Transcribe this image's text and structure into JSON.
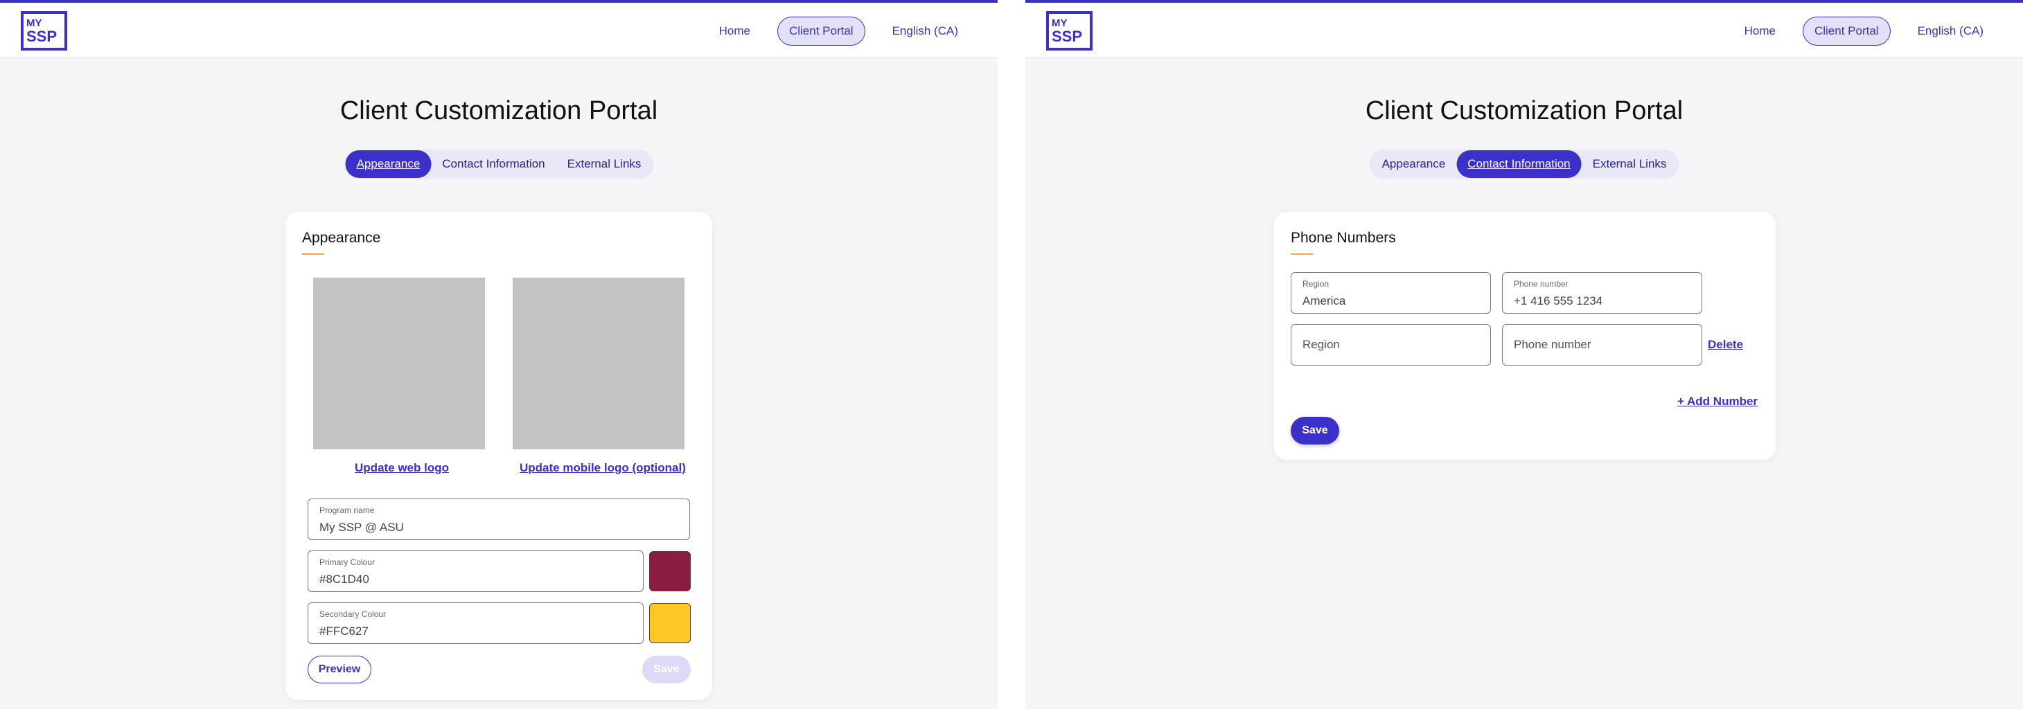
{
  "colors": {
    "accent": "#3b30c9",
    "primary_swatch": "#8C1D40",
    "secondary_swatch": "#FFC627"
  },
  "nav": {
    "logo_line1": "MY",
    "logo_line2": "SSP",
    "links": [
      "Home",
      "Client Portal",
      "English (CA)"
    ],
    "active_link": "Client Portal"
  },
  "page": {
    "title": "Client Customization Portal",
    "tabs": [
      "Appearance",
      "Contact Information",
      "External Links"
    ]
  },
  "appearance": {
    "card_title": "Appearance",
    "update_web_logo": "Update web logo",
    "update_mobile_logo": "Update mobile logo (optional)",
    "program_name": {
      "label": "Program name",
      "value": "My SSP @ ASU"
    },
    "primary_colour": {
      "label": "Primary Colour",
      "value": "#8C1D40"
    },
    "secondary_colour": {
      "label": "Secondary Colour",
      "value": "#FFC627"
    },
    "preview_label": "Preview",
    "save_label": "Save"
  },
  "contact": {
    "card_title": "Phone Numbers",
    "rows": [
      {
        "region_label": "Region",
        "region_value": "America",
        "phone_label": "Phone number",
        "phone_value": "+1 416 555 1234"
      },
      {
        "region_placeholder": "Region",
        "phone_placeholder": "Phone number",
        "delete_label": "Delete"
      }
    ],
    "add_number_label": "+ Add Number",
    "save_label": "Save"
  }
}
